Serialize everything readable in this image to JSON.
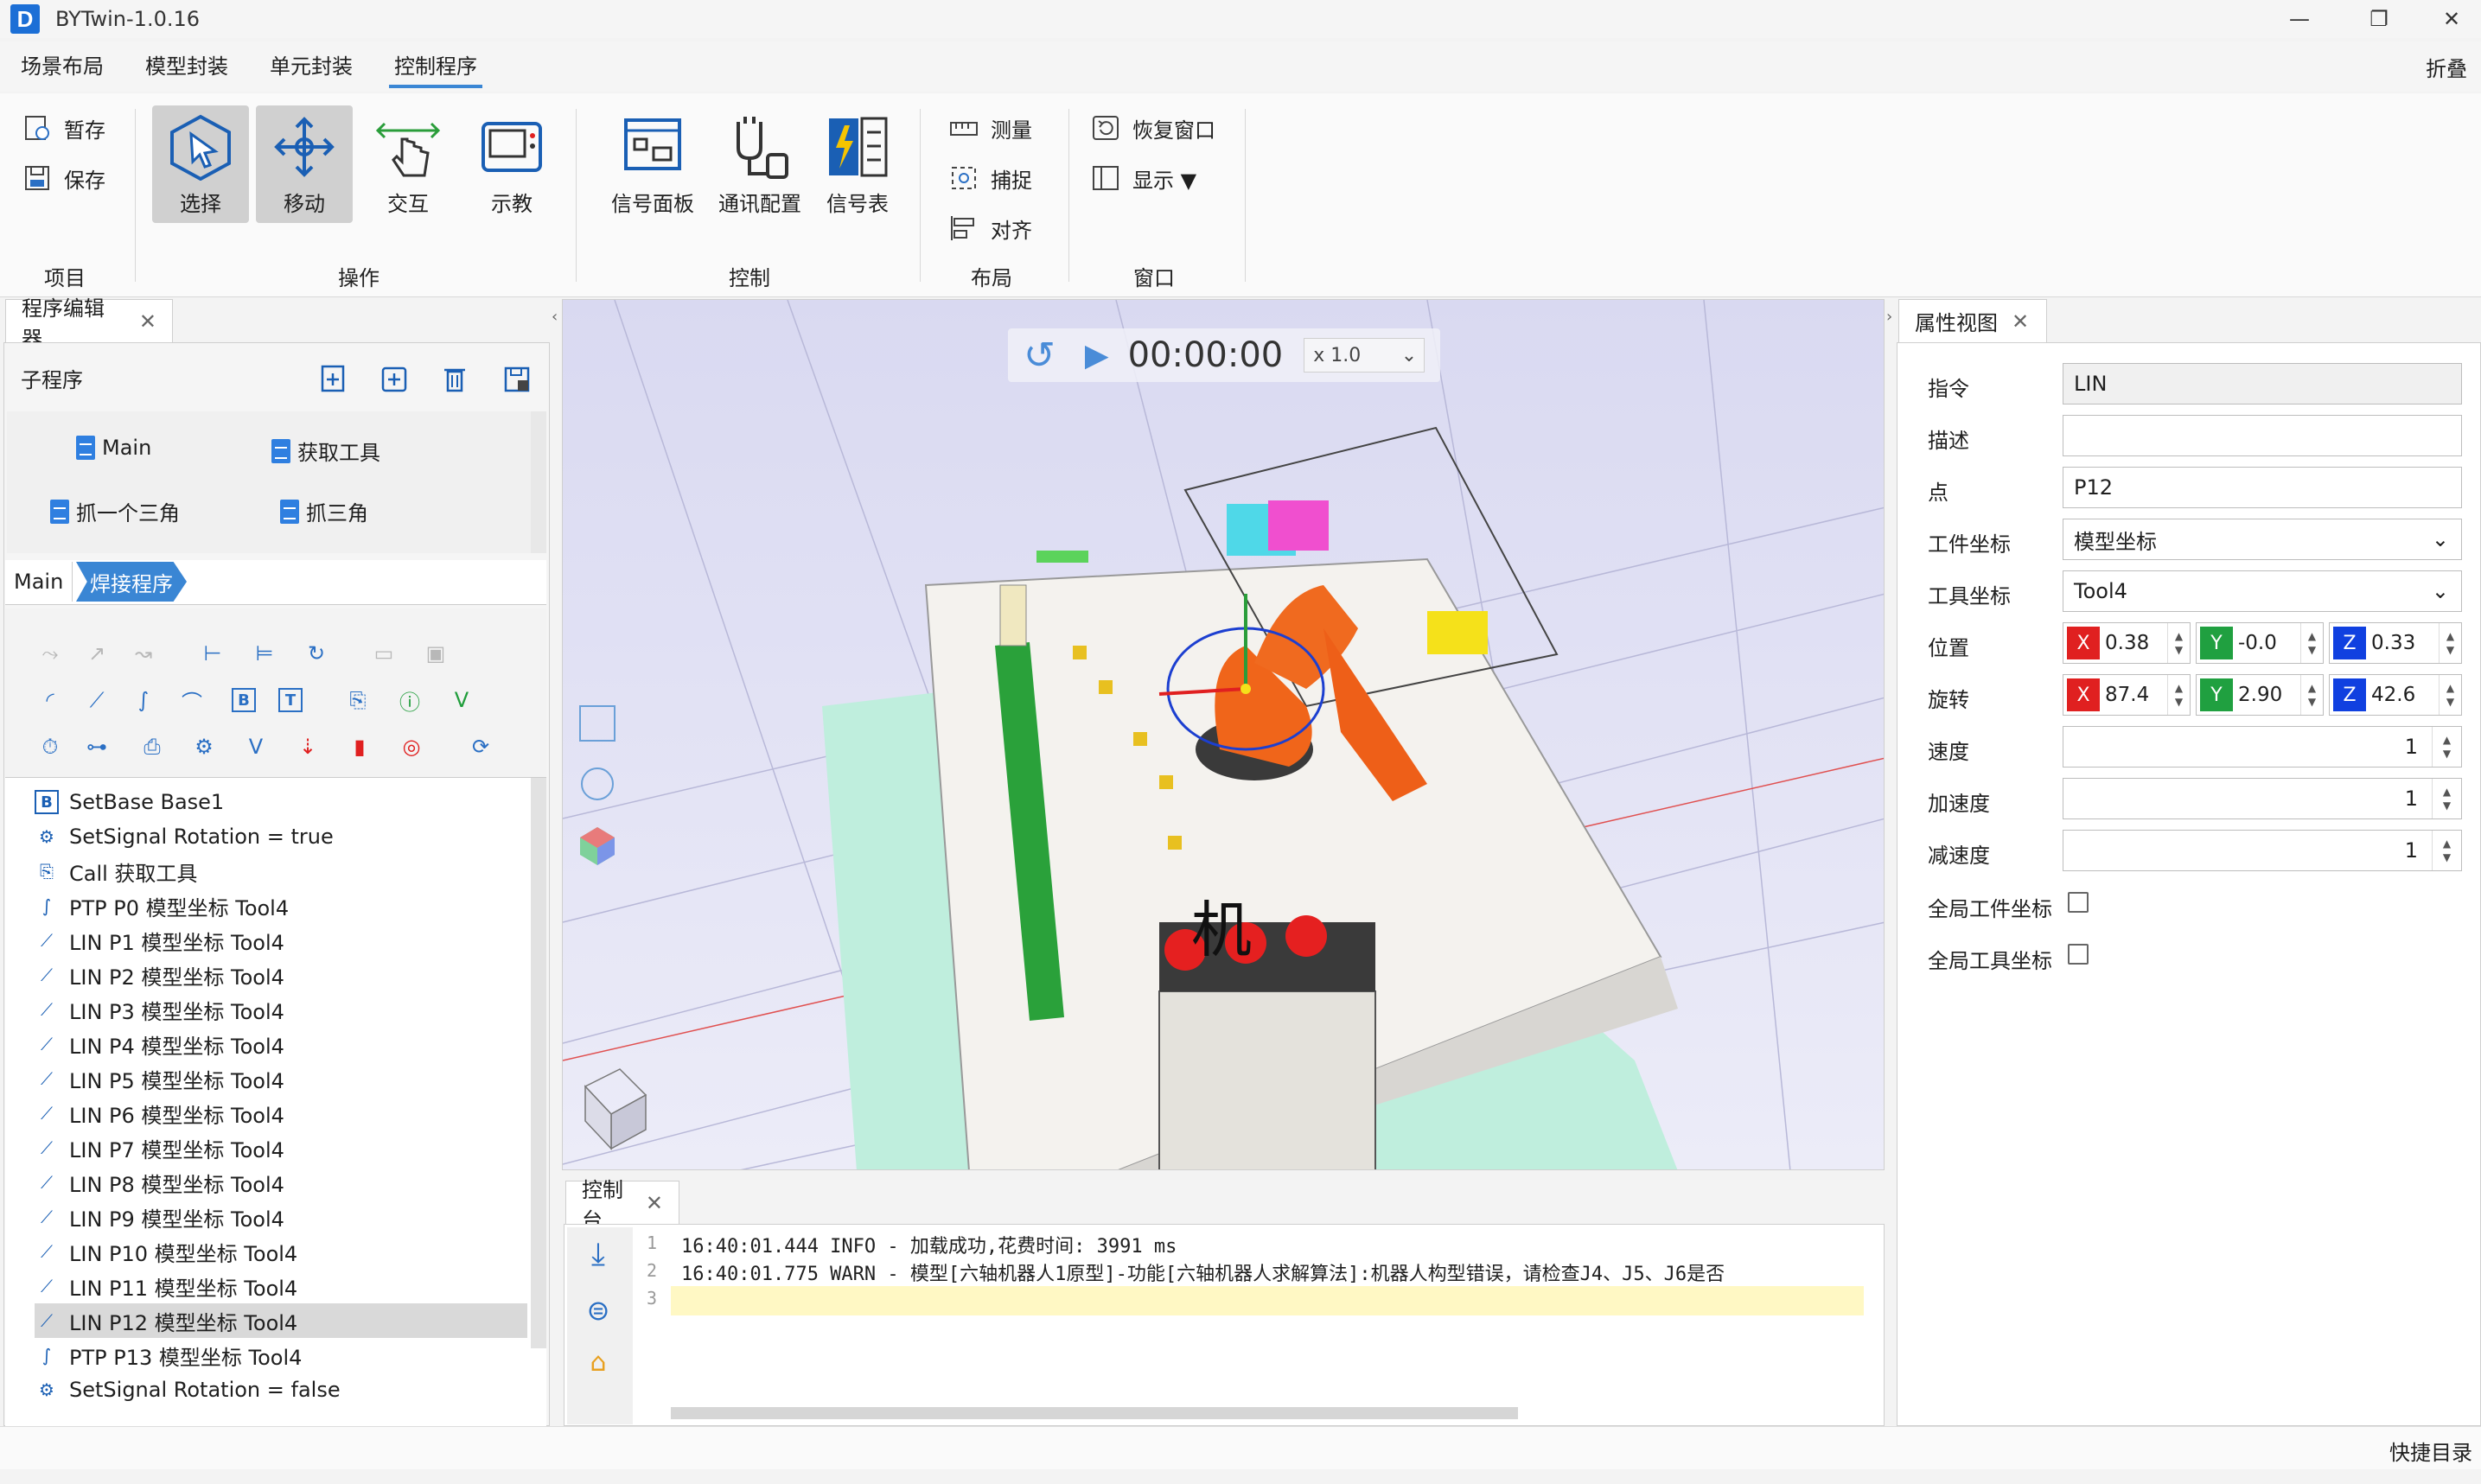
{
  "window": {
    "title": "BYTwin-1.0.16",
    "logo_letter": "D"
  },
  "menu": {
    "items": [
      "场景布局",
      "模型封装",
      "单元封装",
      "控制程序"
    ],
    "active": "控制程序",
    "collapse": "折叠"
  },
  "ribbon": {
    "project": {
      "label": "项目",
      "save_temp": "暂存",
      "save": "保存"
    },
    "operation": {
      "label": "操作",
      "select": "选择",
      "move": "移动",
      "interact": "交互",
      "teach": "示教"
    },
    "control": {
      "label": "控制",
      "signal_panel": "信号面板",
      "comm_config": "通讯配置",
      "signal_table": "信号表"
    },
    "layout": {
      "label": "布局",
      "measure": "测量",
      "snap": "捕捉",
      "align": "对齐"
    },
    "window": {
      "label": "窗口",
      "restore": "恢复窗口",
      "display": "显示 ▼"
    }
  },
  "program_editor": {
    "tab": "程序编辑器",
    "subprogram_label": "子程序",
    "subprograms": [
      "Main",
      "获取工具",
      "抓一个三角",
      "抓三角"
    ],
    "breadcrumb": [
      "Main",
      "焊接程序"
    ],
    "lines": [
      {
        "icon": "B",
        "text": "SetBase Base1"
      },
      {
        "icon": "gear",
        "text": "SetSignal Rotation = true"
      },
      {
        "icon": "call",
        "text": "Call 获取工具"
      },
      {
        "icon": "ptp",
        "text": "PTP P0 模型坐标 Tool4"
      },
      {
        "icon": "lin",
        "text": "LIN P1 模型坐标 Tool4"
      },
      {
        "icon": "lin",
        "text": "LIN P2 模型坐标 Tool4"
      },
      {
        "icon": "lin",
        "text": "LIN P3 模型坐标 Tool4"
      },
      {
        "icon": "lin",
        "text": "LIN P4 模型坐标 Tool4"
      },
      {
        "icon": "lin",
        "text": "LIN P5 模型坐标 Tool4"
      },
      {
        "icon": "lin",
        "text": "LIN P6 模型坐标 Tool4"
      },
      {
        "icon": "lin",
        "text": "LIN P7 模型坐标 Tool4"
      },
      {
        "icon": "lin",
        "text": "LIN P8 模型坐标 Tool4"
      },
      {
        "icon": "lin",
        "text": "LIN P9 模型坐标 Tool4"
      },
      {
        "icon": "lin",
        "text": "LIN P10 模型坐标 Tool4"
      },
      {
        "icon": "lin",
        "text": "LIN P11 模型坐标 Tool4"
      },
      {
        "icon": "lin",
        "text": "LIN P12 模型坐标 Tool4",
        "selected": true
      },
      {
        "icon": "ptp",
        "text": "PTP P13 模型坐标 Tool4"
      },
      {
        "icon": "gear",
        "text": "SetSignal Rotation = false"
      }
    ]
  },
  "viewport": {
    "time": "00:00:00",
    "speed": "x 1.0",
    "scene_text": "机"
  },
  "console": {
    "tab": "控制台",
    "line_numbers": [
      "1",
      "2",
      "3"
    ],
    "lines": [
      "16:40:01.444 INFO  - 加载成功,花费时间: 3991 ms",
      "16:40:01.775 WARN  - 模型[六轴机器人1原型]-功能[六轴机器人求解算法]:机器人构型错误，请检查J4、J5、J6是否",
      ""
    ]
  },
  "properties": {
    "tab": "属性视图",
    "labels": {
      "command": "指令",
      "description": "描述",
      "point": "点",
      "work_coord": "工件坐标",
      "tool_coord": "工具坐标",
      "position": "位置",
      "rotation": "旋转",
      "speed": "速度",
      "accel": "加速度",
      "decel": "减速度",
      "global_work": "全局工件坐标",
      "global_tool": "全局工具坐标"
    },
    "values": {
      "command": "LIN",
      "description": "",
      "point": "P12",
      "work_coord": "模型坐标",
      "tool_coord": "Tool4",
      "speed": "1",
      "accel": "1",
      "decel": "1"
    },
    "position": {
      "x": "0.38",
      "y": "-0.0",
      "z": "0.33"
    },
    "rotation": {
      "x": "87.4",
      "y": "2.90",
      "z": "42.6"
    },
    "axis_tags": {
      "x": "X",
      "y": "Y",
      "z": "Z"
    },
    "colors": {
      "x": "#e02020",
      "y": "#20a040",
      "z": "#1040e0"
    }
  },
  "status": {
    "quick_dir": "快捷目录"
  }
}
